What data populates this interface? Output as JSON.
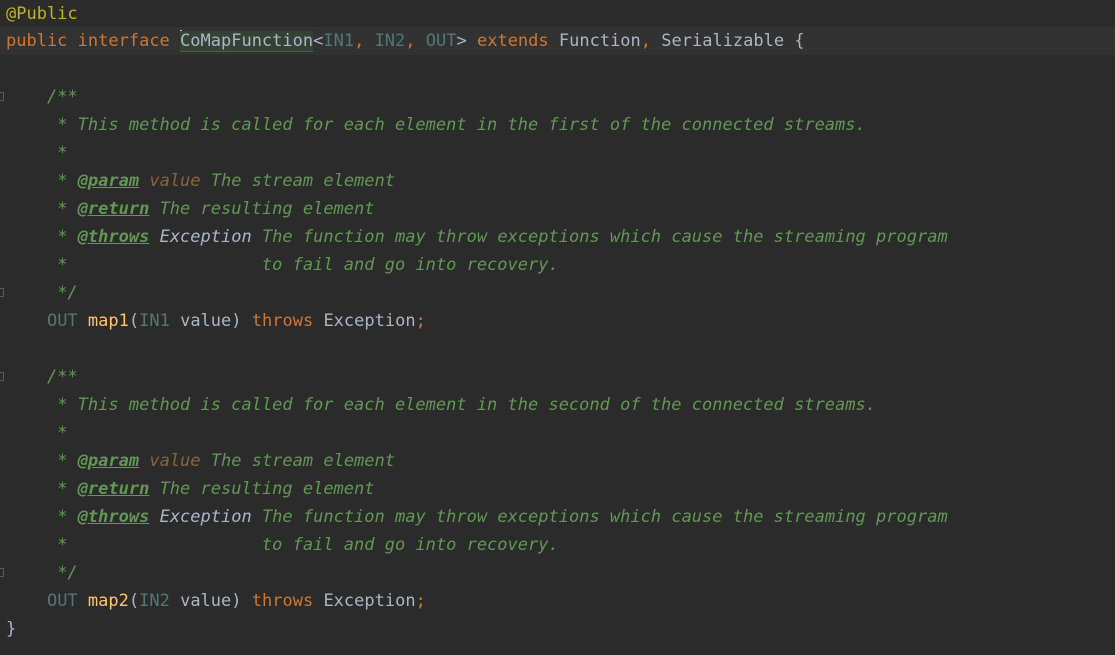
{
  "editor": {
    "line1": {
      "annotation": "@Public"
    },
    "line2": {
      "kw_public": "public",
      "kw_interface": "interface",
      "class_name": "CoMapFunction",
      "lt": "<",
      "tp1": "IN1",
      "comma1": ", ",
      "tp2": "IN2",
      "comma2": ", ",
      "tp3": "OUT",
      "gt": ">",
      "kw_extends": "extends",
      "iface1": "Function",
      "comma3": ",",
      "iface2": "Serializable",
      "brace": "{"
    },
    "method1": {
      "doc_open": "/**",
      "doc_desc": " * This method is called for each element in the first of the connected streams.",
      "doc_blank": " *",
      "doc_star": " * ",
      "tag_param": "@param",
      "param_name": "value",
      "param_desc": " The stream element",
      "tag_return": "@return",
      "return_desc": " The resulting element",
      "tag_throws": "@throws",
      "throws_type": "Exception",
      "throws_desc": " The function may throw exceptions which cause the streaming program",
      "throws_cont": " *                   to fail and go into recovery.",
      "doc_close": " */",
      "ret_type": "OUT",
      "name": "map1",
      "open_paren": "(",
      "arg_type": "IN1",
      "arg_name": " value",
      "close_paren": ")",
      "kw_throws": "throws",
      "exc": "Exception",
      "semi": ";"
    },
    "method2": {
      "doc_open": "/**",
      "doc_desc": " * This method is called for each element in the second of the connected streams.",
      "doc_blank": " *",
      "doc_star": " * ",
      "tag_param": "@param",
      "param_name": "value",
      "param_desc": " The stream element",
      "tag_return": "@return",
      "return_desc": " The resulting element",
      "tag_throws": "@throws",
      "throws_type": "Exception",
      "throws_desc": " The function may throw exceptions which cause the streaming program",
      "throws_cont": " *                   to fail and go into recovery.",
      "doc_close": " */",
      "ret_type": "OUT",
      "name": "map2",
      "open_paren": "(",
      "arg_type": "IN2",
      "arg_name": " value",
      "close_paren": ")",
      "kw_throws": "throws",
      "exc": "Exception",
      "semi": ";"
    },
    "closing_brace": "}"
  }
}
